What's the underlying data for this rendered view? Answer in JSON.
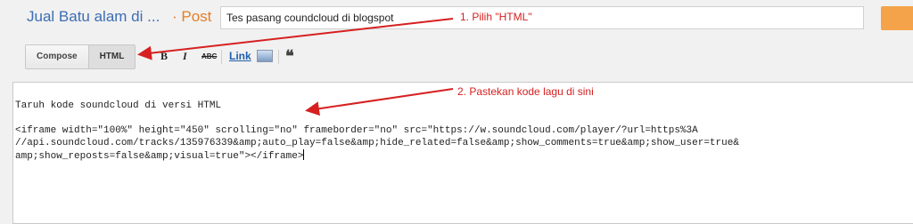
{
  "header": {
    "blog_title": "Jual Batu alam di ...",
    "post_label": "· Post",
    "post_title_value": "Tes pasang coundcloud di blogspot",
    "publish_label": ""
  },
  "toolbar": {
    "compose_label": "Compose",
    "html_label": "HTML",
    "bold_icon": "bold-icon",
    "italic_icon": "italic-icon",
    "strike_label": "ABC",
    "link_label": "Link",
    "image_icon": "image-icon",
    "quote_icon": "quote-icon"
  },
  "editor": {
    "line1": "Taruh kode soundcloud di versi HTML",
    "line2": "",
    "line3": "<iframe width=\"100%\" height=\"450\" scrolling=\"no\" frameborder=\"no\" src=\"https://w.soundcloud.com/player/?url=https%3A",
    "line4": "//api.soundcloud.com/tracks/135976339&amp;auto_play=false&amp;hide_related=false&amp;show_comments=true&amp;show_user=true&",
    "line5": "amp;show_reposts=false&amp;visual=true\"></iframe>"
  },
  "annotations": {
    "step1": "1. Pilih \"HTML\"",
    "step2": "2. Pastekan kode lagu di sini",
    "color": "#d62020"
  },
  "colors": {
    "blog_title": "#3d6db3",
    "post_label": "#e57e26",
    "publish_button": "#f4a34a",
    "link": "#1f5fae"
  }
}
